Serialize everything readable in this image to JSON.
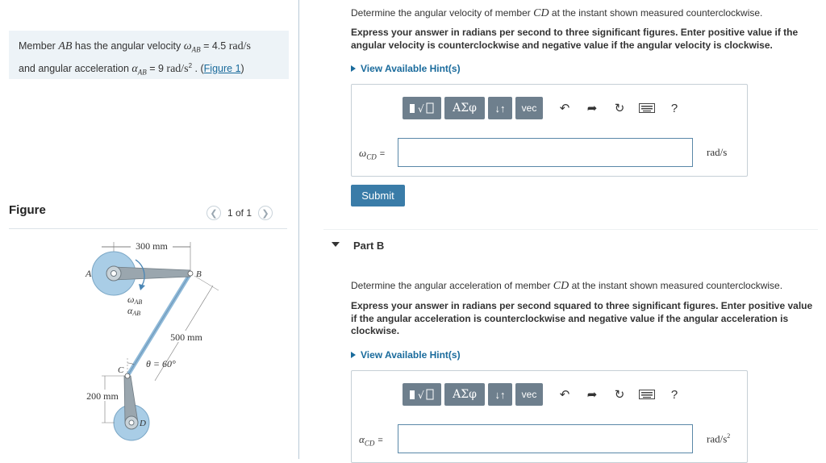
{
  "problem": {
    "line1_prefix": "Member ",
    "member": "AB",
    "line1_mid": " has the angular velocity ",
    "omega_sym": "ω",
    "omega_sub": "AB",
    "omega_eq": " = 4.5 ",
    "omega_unit": "rad/s",
    "line2_prefix": "and angular acceleration ",
    "alpha_sym": "α",
    "alpha_sub": "AB",
    "alpha_eq": " = 9 ",
    "alpha_unit": "rad/s",
    "alpha_unit_exp": "2",
    "sep": " . (",
    "figure_link": "Figure 1",
    "close": ")"
  },
  "figure_panel": {
    "title": "Figure",
    "pager_text": "1 of 1",
    "prev_icon": "chevron-left-icon",
    "next_icon": "chevron-right-icon",
    "labels": {
      "dim_top": "300 mm",
      "A": "A",
      "B": "B",
      "C": "C",
      "D": "D",
      "omega": "ω",
      "omega_sub": "AB",
      "alpha": "α",
      "alpha_sub": "AB",
      "dim_bc": "500 mm",
      "theta": "θ = 60°",
      "dim_left": "200 mm"
    }
  },
  "partA": {
    "question_prefix": "Determine the angular velocity of member ",
    "member": "CD",
    "question_suffix": " at the instant shown measured counterclockwise.",
    "instructions": "Express your answer in radians per second to three significant figures. Enter positive value if the angular velocity is counterclockwise and negative value if the angular velocity is clockwise.",
    "hint_label": "View Available Hint(s)",
    "answer_label_sym": "ω",
    "answer_label_sub": "CD",
    "answer_label_eq": "=",
    "answer_value": "",
    "unit": "rad/s",
    "submit_label": "Submit"
  },
  "partB": {
    "title": "Part B",
    "question_prefix": "Determine the angular acceleration of member ",
    "member": "CD",
    "question_suffix": " at the instant shown measured counterclockwise.",
    "instructions": "Express your answer in radians per second squared to three significant figures. Enter positive value if the angular acceleration is counterclockwise and negative value if the angular acceleration is clockwise.",
    "hint_label": "View Available Hint(s)",
    "answer_label_sym": "α",
    "answer_label_sub": "CD",
    "answer_label_eq": "=",
    "answer_value": "",
    "unit": "rad/s",
    "unit_exp": "2"
  },
  "toolbar": {
    "templates": "template-icon",
    "greek": "ΑΣφ",
    "arrows": "↓↑",
    "vec": "vec",
    "undo": "undo-icon",
    "redo": "redo-icon",
    "reset": "reset-icon",
    "keyboard": "keyboard-icon",
    "help": "?"
  },
  "colors": {
    "link": "#1a6b9c",
    "accent": "#3a7ca8",
    "toolbar_btn": "#6e7f8d",
    "panel_bg": "#edf3f7",
    "wheel": "#a9cde6",
    "link_bar": "#8fb9d8"
  }
}
